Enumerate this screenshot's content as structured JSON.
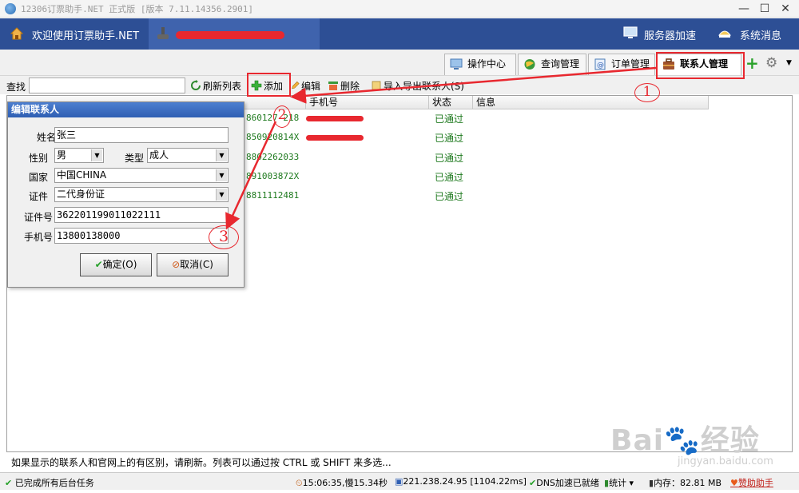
{
  "window": {
    "title": "12306订票助手.NET  正式版 [版本 7.11.14356.2901]",
    "controls": {
      "minimize": "—",
      "maximize": "☐",
      "close": "✕"
    }
  },
  "header": {
    "welcome": "欢迎使用订票助手.NET",
    "server_speed": "服务器加速",
    "system_msg": "系统消息",
    "colors": {
      "bar": "#2d4f95",
      "user_box": "#3f63ad"
    }
  },
  "tabs": [
    {
      "label": "操作中心",
      "icon": "monitor-icon"
    },
    {
      "label": "查询管理",
      "icon": "globe-icon"
    },
    {
      "label": "订单管理",
      "icon": "order-icon"
    },
    {
      "label": "联系人管理",
      "icon": "briefcase-icon",
      "active": true
    }
  ],
  "toolbar": {
    "find_label": "查找",
    "find_value": "",
    "refresh": "刷新列表",
    "add": "添加",
    "edit": "编辑",
    "delete": "删除",
    "import": "导入导出联系人(S)"
  },
  "list": {
    "columns": {
      "phone": "手机号",
      "status": "状态",
      "info": "信息"
    },
    "rows": [
      {
        "id_suffix": "860127 218",
        "status": "已通过"
      },
      {
        "id_suffix": "850920814X",
        "status": "已通过"
      },
      {
        "id_suffix": "8802262033",
        "status": "已通过"
      },
      {
        "id_suffix": "891003872X",
        "status": "已通过"
      },
      {
        "id_suffix": "8811112481",
        "status": "已通过"
      }
    ]
  },
  "dialog": {
    "title": "编辑联系人",
    "name_label": "姓名",
    "name_value": "张三",
    "gender_label": "性别",
    "gender_value": "男",
    "type_label": "类型",
    "type_value": "成人",
    "country_label": "国家",
    "country_value": "中国CHINA",
    "doc_label": "证件",
    "doc_value": "二代身份证",
    "docno_label": "证件号",
    "docno_value": "362201199011022111",
    "phone_label": "手机号",
    "phone_value": "13800138000",
    "ok": "确定(O)",
    "cancel": "取消(C)"
  },
  "info_text": "如果显示的联系人和官网上的有区别，请刷新。列表可以通过按 CTRL 或 SHIFT 来多选...",
  "statusbar": {
    "tasks": "已完成所有后台任务",
    "time": "15:06:35,慢15.34秒",
    "ip": "221.238.24.95 [1104.22ms]",
    "dns": "DNS加速已就绪",
    "stats": "统计",
    "memory": "内存：82.81 MB",
    "sponsor": "赞助助手"
  },
  "annotations": {
    "n1": "1",
    "n2": "2",
    "n3": "3",
    "color": "#e8282f"
  },
  "watermark": {
    "brand": "Bai",
    "brand_cn": "经验",
    "url": "jingyan.baidu.com"
  }
}
